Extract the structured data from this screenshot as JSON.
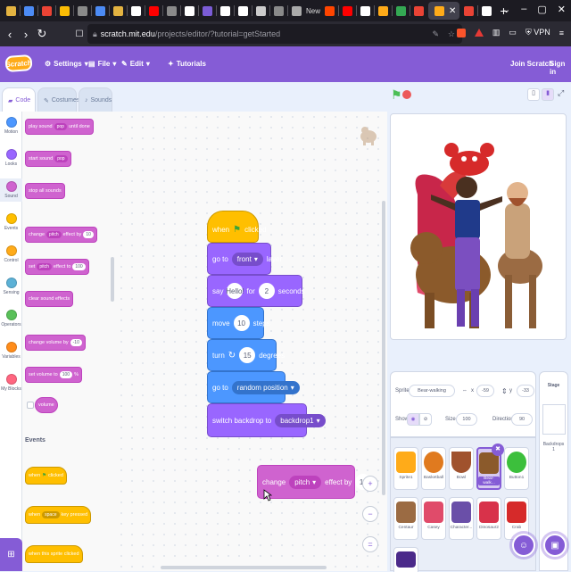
{
  "browser": {
    "new_tab_label": "New",
    "url_host": "scratch.mit.edu",
    "url_path": "/projects/editor/?tutorial=getStarted",
    "vpn_label": "VPN"
  },
  "menubar": {
    "logo": "Scratch",
    "settings": "Settings",
    "file": "File",
    "edit": "Edit",
    "tutorials": "Tutorials",
    "join": "Join Scratch",
    "signin": "Sign in"
  },
  "editor_tabs": {
    "code": "Code",
    "costumes": "Costumes",
    "sounds": "Sounds"
  },
  "categories": [
    {
      "label": "Motion",
      "color": "#4c97ff"
    },
    {
      "label": "Looks",
      "color": "#9966ff"
    },
    {
      "label": "Sound",
      "color": "#cf63cf"
    },
    {
      "label": "Events",
      "color": "#ffbf00"
    },
    {
      "label": "Control",
      "color": "#ffab19"
    },
    {
      "label": "Sensing",
      "color": "#5cb1d6"
    },
    {
      "label": "Operators",
      "color": "#59c059"
    },
    {
      "label": "Variables",
      "color": "#ff8c1a"
    },
    {
      "label": "My Blocks",
      "color": "#ff6680"
    }
  ],
  "palette": {
    "play_sound_a": "play sound",
    "play_sound_dd": "pop",
    "play_sound_b": "until done",
    "start_sound": "start sound",
    "start_sound_dd": "pop",
    "stop_all": "stop all sounds",
    "change_effect_a": "change",
    "change_effect_dd": "pitch",
    "change_effect_b": "effect by",
    "change_effect_val": "10",
    "set_effect_a": "set",
    "set_effect_dd": "pitch",
    "set_effect_b": "effect to",
    "set_effect_val": "100",
    "clear_effects": "clear sound effects",
    "change_volume": "change volume by",
    "change_volume_val": "-10",
    "set_volume": "set volume to",
    "set_volume_val": "100",
    "set_volume_unit": "%",
    "volume": "volume",
    "events_title": "Events",
    "when_flag_a": "when",
    "when_flag_b": "clicked",
    "when_key_a": "when",
    "when_key_dd": "space",
    "when_key_b": "key pressed",
    "when_sprite": "when this sprite clicked"
  },
  "script": {
    "hat_when": "when",
    "hat_clicked": "clicked",
    "goto_layer_a": "go to",
    "goto_layer_dd": "front",
    "goto_layer_b": "layer",
    "say_a": "say",
    "say_text": "Hello!",
    "say_for": "for",
    "say_secs": "2",
    "say_b": "seconds",
    "move_a": "move",
    "move_val": "10",
    "move_b": "steps",
    "turn_a": "turn",
    "turn_val": "15",
    "turn_b": "degrees",
    "goto_pos_a": "go to",
    "goto_pos_dd": "random position",
    "backdrop_a": "switch backdrop to",
    "backdrop_dd": "backdrop1"
  },
  "floating_block": {
    "a": "change",
    "dd": "pitch",
    "b": "effect by",
    "val": "10"
  },
  "zoom": {
    "in": "+",
    "out": "−",
    "reset": "="
  },
  "sprite_info": {
    "sprite_label": "Sprite",
    "sprite_name": "Bear-walking",
    "x_label": "x",
    "x_val": "-59",
    "y_label": "y",
    "y_val": "-33",
    "show_label": "Show",
    "size_label": "Size",
    "size_val": "100",
    "direction_label": "Direction",
    "direction_val": "90"
  },
  "sprites": [
    {
      "name": "Sprite1",
      "color": "#ffab19"
    },
    {
      "name": "Basketball",
      "color": "#e07a1f"
    },
    {
      "name": "Bowl",
      "color": "#a0522d"
    },
    {
      "name": "Bear-walk...",
      "color": "#8b5a2b"
    },
    {
      "name": "Button1",
      "color": "#3cbf3c"
    },
    {
      "name": "Centaur",
      "color": "#9b6b43"
    },
    {
      "name": "Casey",
      "color": "#e04b6a"
    },
    {
      "name": "Character...",
      "color": "#6a4fa8"
    },
    {
      "name": "Dinosaur2",
      "color": "#d8324a"
    },
    {
      "name": "Crab",
      "color": "#d62a2a"
    }
  ],
  "stage_panel": {
    "title": "Stage",
    "backdrops_label": "Backdrops",
    "backdrops_count": "1"
  }
}
